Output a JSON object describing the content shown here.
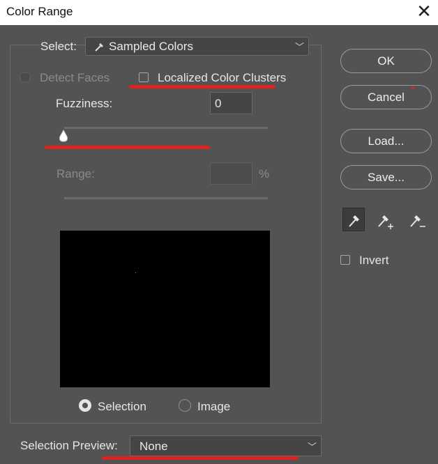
{
  "window": {
    "title": "Color Range"
  },
  "select": {
    "label": "Select:",
    "value": "Sampled Colors"
  },
  "detect_faces": {
    "label": "Detect Faces",
    "checked": false,
    "enabled": false
  },
  "localized_clusters": {
    "label": "Localized Color Clusters",
    "checked": false
  },
  "fuzziness": {
    "label": "Fuzziness:",
    "value": "0",
    "slider_fraction": 0
  },
  "range": {
    "label": "Range:",
    "value": "",
    "unit": "%",
    "enabled": false
  },
  "preview_mode": {
    "selection_label": "Selection",
    "image_label": "Image",
    "selected": "Selection"
  },
  "buttons": {
    "ok": "OK",
    "cancel": "Cancel",
    "load": "Load...",
    "save": "Save..."
  },
  "tools": [
    "eyedropper-icon",
    "eyedropper-plus-icon",
    "eyedropper-minus-icon"
  ],
  "invert": {
    "label": "Invert",
    "checked": false
  },
  "selection_preview": {
    "label": "Selection Preview:",
    "value": "None"
  },
  "colors": {
    "background": "#535353",
    "highlight": "#dd2222",
    "preview": "#000000"
  }
}
